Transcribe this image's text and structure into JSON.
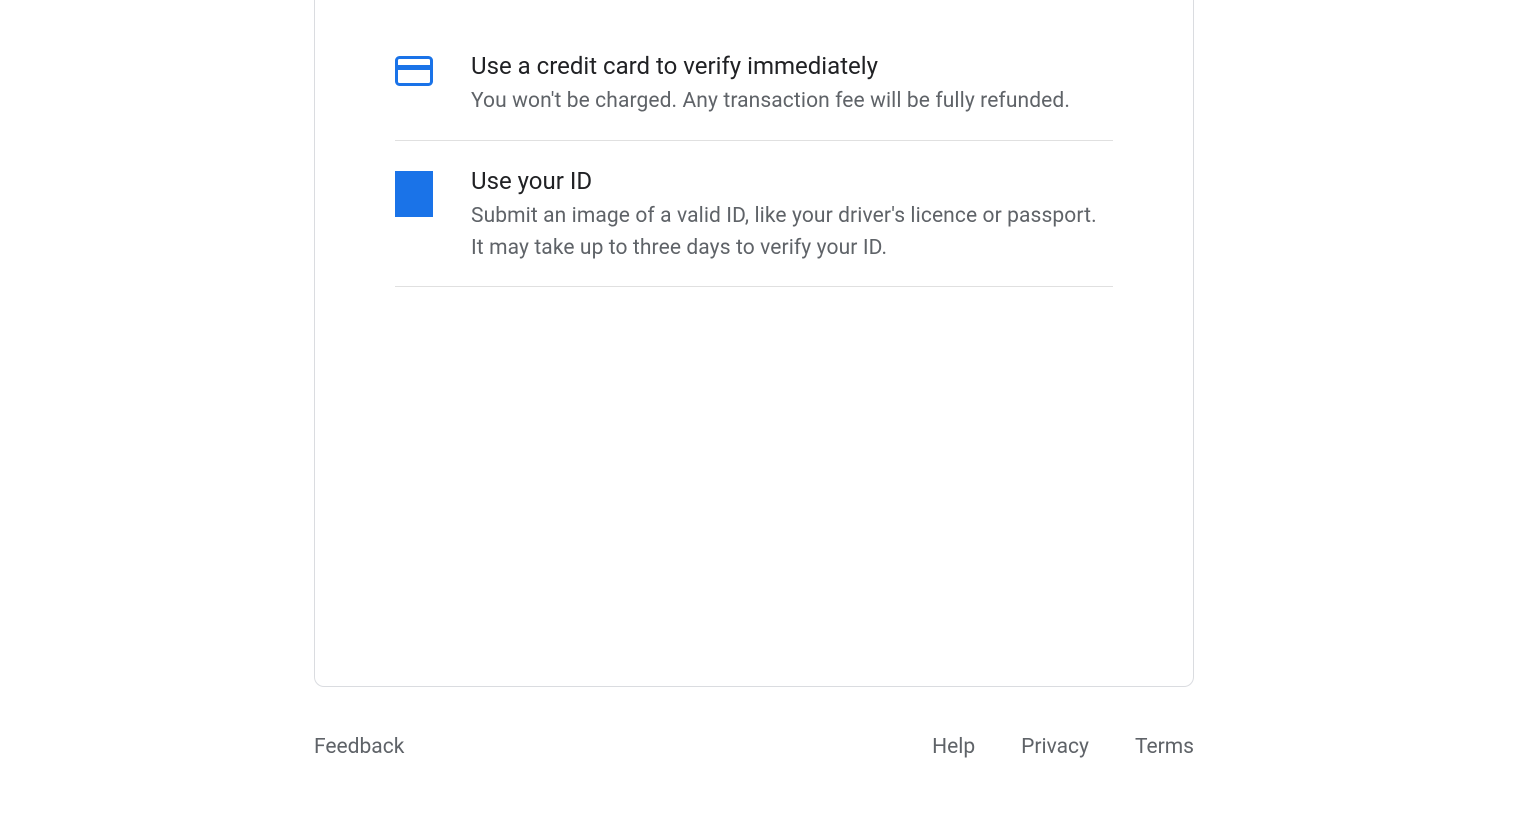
{
  "options": [
    {
      "title": "Use a credit card to verify immediately",
      "description": "You won't be charged. Any transaction fee will be fully refunded."
    },
    {
      "title": "Use your ID",
      "description": "Submit an image of a valid ID, like your driver's licence or passport. It may take up to three days to verify your ID."
    }
  ],
  "footer": {
    "feedback": "Feedback",
    "help": "Help",
    "privacy": "Privacy",
    "terms": "Terms"
  },
  "colors": {
    "accent": "#1a73e8",
    "text_primary": "#202124",
    "text_secondary": "#5f6368",
    "border": "#dadce0"
  }
}
